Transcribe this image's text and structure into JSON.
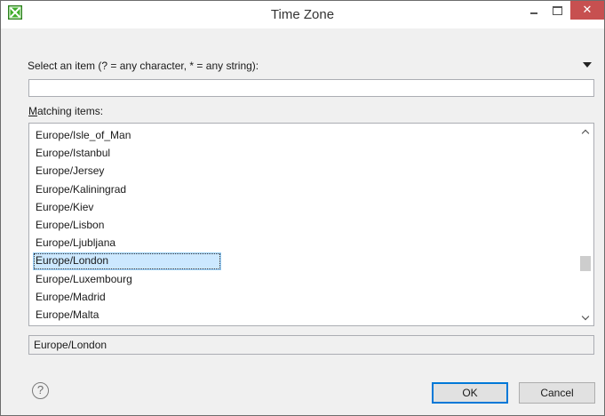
{
  "window": {
    "title": "Time Zone",
    "minimize_glyph": "minimize-icon",
    "maximize_glyph": "maximize-icon",
    "close_glyph": "✕"
  },
  "filter": {
    "prompt": "Select an item (? = any character, * = any string):",
    "value": "",
    "placeholder": ""
  },
  "matching": {
    "label_mnemonic": "M",
    "label_rest": "atching items:",
    "items": [
      "Europe/Isle_of_Man",
      "Europe/Istanbul",
      "Europe/Jersey",
      "Europe/Kaliningrad",
      "Europe/Kiev",
      "Europe/Lisbon",
      "Europe/Ljubljana",
      "Europe/London",
      "Europe/Luxembourg",
      "Europe/Madrid",
      "Europe/Malta"
    ],
    "selected_index": 7
  },
  "status": {
    "text": "Europe/London"
  },
  "footer": {
    "help_glyph": "?",
    "ok_label": "OK",
    "cancel_label": "Cancel"
  },
  "colors": {
    "close_button": "#c75050",
    "selection_fill": "#cce8ff",
    "selection_border": "#99d1ff",
    "default_button_border": "#0078d7",
    "app_icon": "#3fae2a"
  }
}
